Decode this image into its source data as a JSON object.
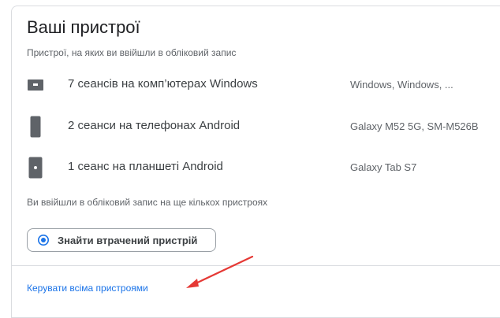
{
  "devices_card": {
    "title": "Ваші пристрої",
    "subtitle": "Пристрої, на яких ви ввійшли в обліковий запис",
    "devices": [
      {
        "name": "7 сеансів на комп’ютерах Windows",
        "detail": "Windows, Windows, ...",
        "icon": "computer-icon"
      },
      {
        "name": "2 сеанси на телефонах Android",
        "detail": "Galaxy M52 5G, SM-M526B",
        "icon": "phone-icon"
      },
      {
        "name": "1 сеанс на планшеті Android",
        "detail": "Galaxy Tab S7",
        "icon": "tablet-icon"
      }
    ],
    "note": "Ви ввійшли в обліковий запис на ще кількох пристроях",
    "find_button": {
      "label": "Знайти втрачений пристрій",
      "icon": "locate-icon"
    },
    "manage_link": "Керувати всіма пристроями"
  },
  "colors": {
    "link": "#1a73e8",
    "arrow": "#e53935",
    "icon": "#5f6368"
  }
}
